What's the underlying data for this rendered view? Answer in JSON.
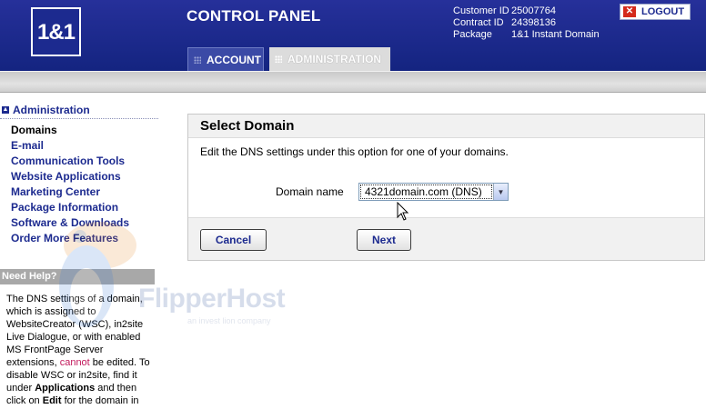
{
  "header": {
    "logo_text": "1&1",
    "title": "CONTROL PANEL",
    "info": [
      {
        "label": "Customer ID",
        "value": "25007764"
      },
      {
        "label": "Contract ID",
        "value": "24398136"
      },
      {
        "label": "Package",
        "value": "1&1 Instant Domain"
      }
    ],
    "logout_label": "LOGOUT",
    "tabs": [
      {
        "label": "ACCOUNT",
        "active": false
      },
      {
        "label": "ADMINISTRATION",
        "active": true
      }
    ]
  },
  "sidebar": {
    "heading": "Administration",
    "items": [
      {
        "label": "Domains",
        "active": true
      },
      {
        "label": "E-mail",
        "active": false
      },
      {
        "label": "Communication Tools",
        "active": false
      },
      {
        "label": "Website Applications",
        "active": false
      },
      {
        "label": "Marketing Center",
        "active": false
      },
      {
        "label": "Package Information",
        "active": false
      },
      {
        "label": "Software & Downloads",
        "active": false
      },
      {
        "label": "Order More Features",
        "active": false
      }
    ],
    "help_heading": "Need Help?",
    "help_text": {
      "p1": "The DNS settings of a domain, which is assigned to WebsiteCreator (WSC), in2site Live Dialogue, or with enabled MS FrontPage Server extensions, ",
      "p1_warn": "cannot",
      "p2": " be edited. To disable WSC or in2site, find it under ",
      "p2_bold": "Applications",
      "p3": " and then click on ",
      "p3_bold": "Edit",
      "p4": " for the domain in"
    }
  },
  "main": {
    "title": "Select Domain",
    "description": "Edit the DNS settings under this option for one of your domains.",
    "field_label": "Domain name",
    "select_value": "4321domain.com (DNS)",
    "cancel_label": "Cancel",
    "next_label": "Next"
  },
  "watermark": {
    "text": "FlipperHost",
    "subtext": "an invest lion company"
  },
  "colors": {
    "brand_blue": "#1c2a8f",
    "header_gray": "#c9c9c9",
    "warn": "#c2185b"
  }
}
